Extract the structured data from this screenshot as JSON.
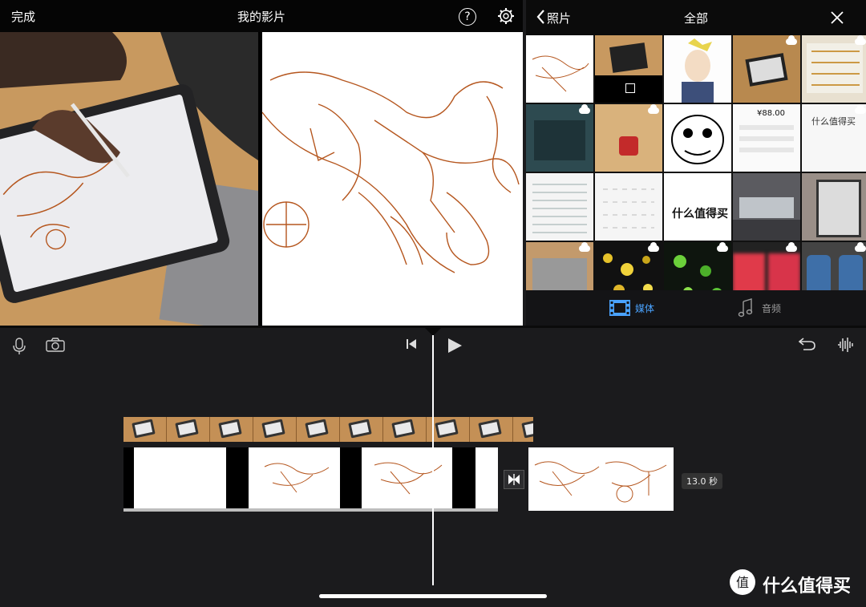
{
  "viewer": {
    "done_label": "完成",
    "title": "我的影片",
    "help_symbol": "?"
  },
  "browser": {
    "back_label": "照片",
    "title": "全部",
    "tabs": [
      {
        "label": "媒体",
        "icon": "film-strip-icon",
        "selected": true
      },
      {
        "label": "音频",
        "icon": "music-note-icon",
        "selected": false
      }
    ],
    "thumb_texts": {
      "price": "¥88.00",
      "handwriting": "什么值得买"
    }
  },
  "timeline": {
    "duration_label": "13.0 秒"
  },
  "watermark": {
    "text": "什么值得买",
    "logo_char": "值"
  },
  "colors": {
    "accent": "#4aa3ff",
    "sketch": "#b5561e",
    "timeline_bg": "#1b1b1d"
  }
}
